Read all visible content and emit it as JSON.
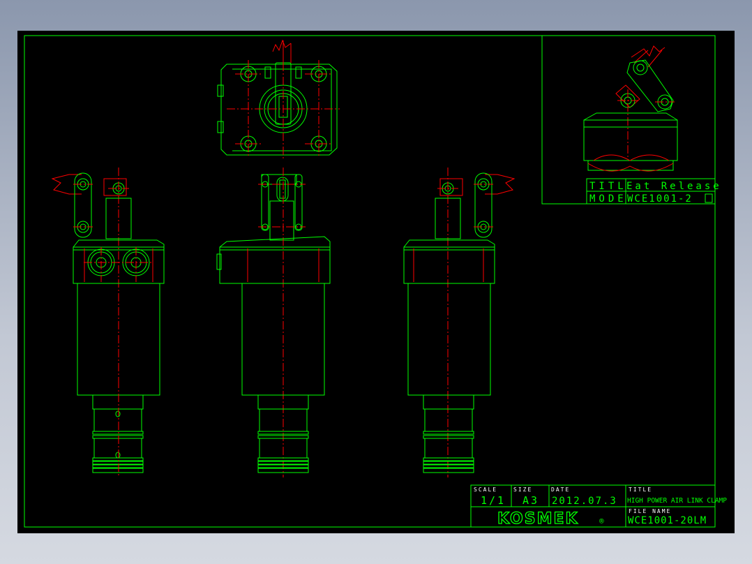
{
  "drawing": {
    "inset": {
      "title_label": "TITL",
      "title_value": "Eat Release",
      "model_label": "MODE",
      "model_value": "WCE1001-2"
    },
    "title_block": {
      "scale_label": "SCALE",
      "scale_value": "1/1",
      "size_label": "SIZE",
      "size_value": "A3",
      "date_label": "DATE",
      "date_value": "2012.07.3",
      "title_label": "TITLE",
      "title_value": "HIGH POWER AIR LINK CLAMP",
      "filename_label": "FILE NAME",
      "filename_value": "WCE1001-20LM",
      "company": "KOSMEK",
      "registered_mark": "®"
    }
  },
  "colors": {
    "outline": "#00ff00",
    "centerline": "#ff0000",
    "background": "#000000"
  }
}
